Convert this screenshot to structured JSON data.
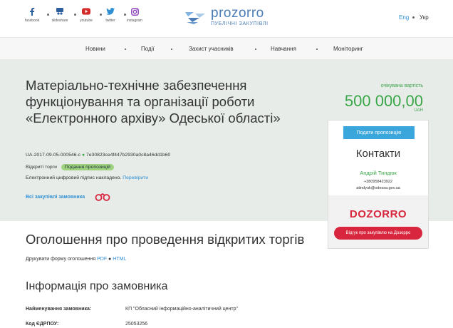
{
  "header": {
    "social": [
      {
        "label": "facebook",
        "icon": "facebook-icon",
        "color": "#2b5f9e"
      },
      {
        "label": "slideshare",
        "icon": "slideshare-icon",
        "color": "#2b5f9e"
      },
      {
        "label": "youtube",
        "icon": "youtube-icon",
        "color": "#d52a2a"
      },
      {
        "label": "twitter",
        "icon": "twitter-icon",
        "color": "#2f8fd2"
      },
      {
        "label": "instagram",
        "icon": "instagram-icon",
        "color": "#8a3ab9"
      }
    ],
    "logo_main": "prozorro",
    "logo_sub": "ПУБЛІЧНІ ЗАКУПІВЛІ",
    "lang_en": "Eng",
    "lang_uk": "Укр"
  },
  "nav": [
    "Новини",
    "Події",
    "Захист учасників",
    "Навчання",
    "Моніторинг"
  ],
  "tender": {
    "title": "Матеріально-технічне забезпечення функціонування та організації роботи «Електронного архіву» Одеської області»",
    "id": "UA-2017-09-05-000546-c",
    "hash": "7e30823ce4f447b2930a0c8a46dd1b60",
    "procedure": "Відкриті торги",
    "status": "Подання пропозицій",
    "signature_text": "Електронний цифровий підпис накладено.",
    "verify_link": "Перевірити",
    "all_link": "Всі закупівлі замовника",
    "expected_label": "очікувана вартість",
    "price": "500 000,00",
    "currency": "UAH"
  },
  "card": {
    "submit_button": "Подати пропозицію",
    "contacts_title": "Контакти",
    "contact_name": "Андрій Тиндюк",
    "phone": "+380958423922",
    "email": "atindyuk@odessa.gov.ua",
    "dozorro_logo": "DOZORRO",
    "dozorro_button": "Відгук про закупівлю на Дозорро"
  },
  "announcement": {
    "heading": "Оголошення про проведення відкритих торгів",
    "print_text": "Друкувати форму оголошення",
    "pdf": "PDF",
    "html": "HTML"
  },
  "customer": {
    "heading": "Інформація про замовника",
    "rows": [
      {
        "key": "Найменування замовника:",
        "value": "КП \"Обласний інформаційно-аналітичний центр\""
      },
      {
        "key": "Код ЄДРПОУ:",
        "value": "25053256"
      }
    ]
  }
}
